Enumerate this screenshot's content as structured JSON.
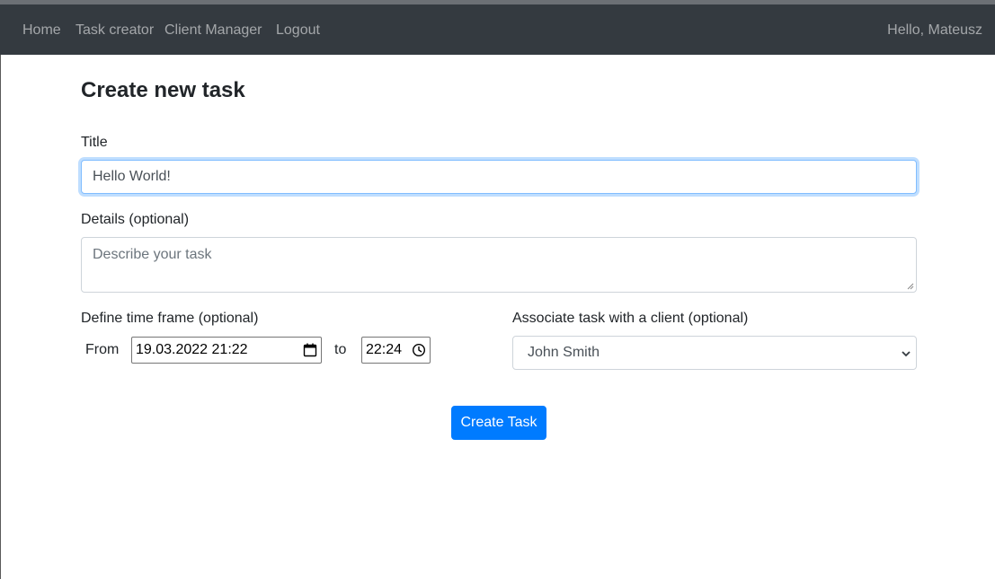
{
  "nav": {
    "links": [
      "Home",
      "Task creator",
      "Client Manager",
      "Logout"
    ],
    "greeting": "Hello, Mateusz"
  },
  "page": {
    "title": "Create new task"
  },
  "form": {
    "title_label": "Title",
    "title_value": "Hello World!",
    "details_label": "Details (optional)",
    "details_placeholder": "Describe your task",
    "timeframe_label": "Define time frame (optional)",
    "from_label": "From",
    "from_value": "19.03.2022 21:22",
    "to_label": "to",
    "to_value": "22:24",
    "client_label": "Associate task with a client (optional)",
    "client_selected": "John Smith",
    "submit_label": "Create Task"
  },
  "icons": {
    "calendar": "calendar-icon",
    "clock": "clock-icon",
    "chevron": "chevron-down-icon"
  },
  "colors": {
    "navbar": "#343a40",
    "primary": "#007bff",
    "focus_border": "#80bdff"
  }
}
